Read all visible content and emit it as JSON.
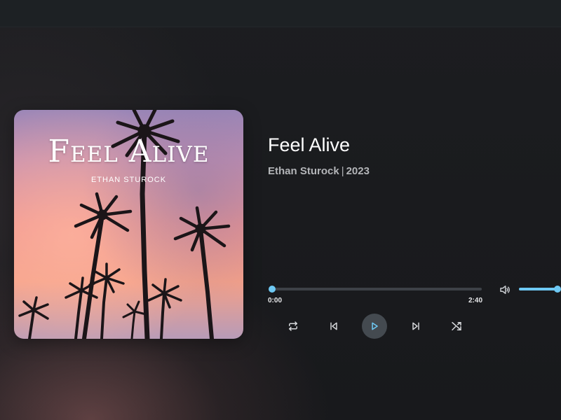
{
  "album": {
    "cover_title": "Feel Alive",
    "cover_artist": "ETHAN STUROCK"
  },
  "track": {
    "title": "Feel Alive",
    "artist": "Ethan Sturock",
    "separator": "|",
    "year": "2023"
  },
  "playback": {
    "current_time": "0:00",
    "total_time": "2:40",
    "progress_fraction": 0.0,
    "volume_fraction": 1.0,
    "playing": false
  },
  "controls": {
    "repeat_icon": "repeat-icon",
    "previous_icon": "skip-previous-icon",
    "play_icon": "play-icon",
    "next_icon": "skip-next-icon",
    "shuffle_icon": "shuffle-icon",
    "volume_icon": "volume-icon"
  },
  "colors": {
    "accent": "#6ec9f4",
    "background": "#17191c",
    "play_button": "#444a50"
  }
}
